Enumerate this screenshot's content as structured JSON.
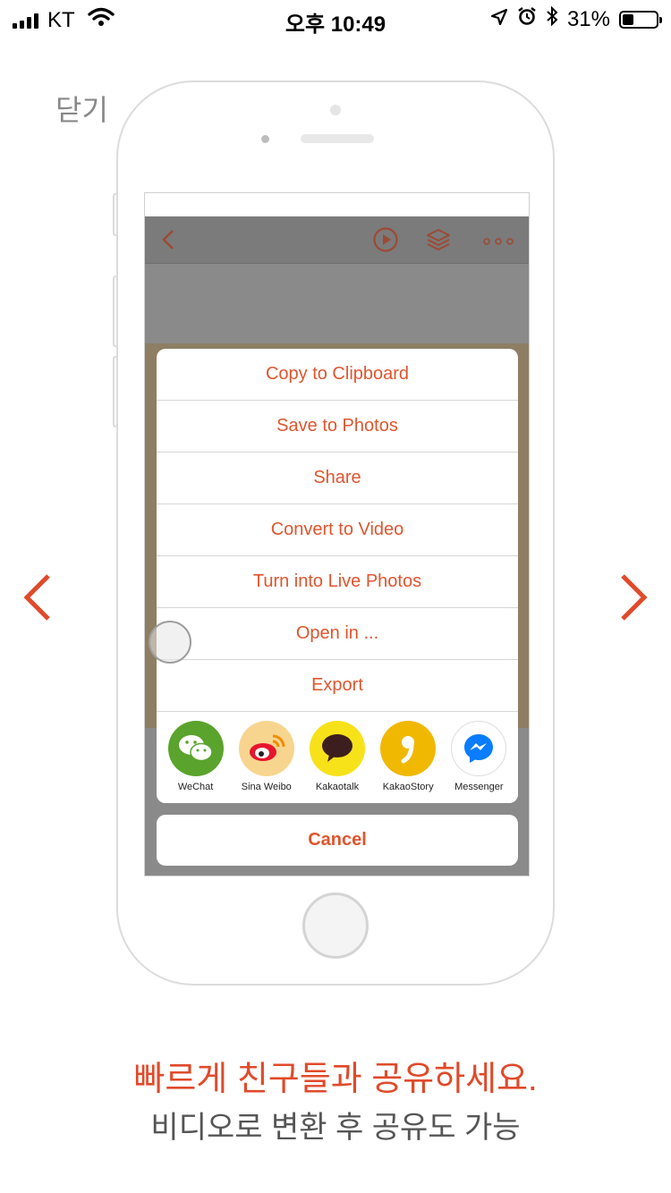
{
  "status_bar": {
    "carrier": "KT",
    "time": "오후 10:49",
    "battery_percent": "31%",
    "battery_level": 0.31,
    "icons": [
      "signal-icon",
      "wifi-icon",
      "location-icon",
      "alarm-icon",
      "bluetooth-icon",
      "battery-icon"
    ]
  },
  "close_label": "닫기",
  "app_toolbar": {
    "icons": [
      "back-chevron-icon",
      "play-icon",
      "layers-icon",
      "more-icon"
    ],
    "accent": "#e0552e"
  },
  "action_sheet": {
    "items": [
      {
        "label": "Copy to Clipboard"
      },
      {
        "label": "Save to Photos"
      },
      {
        "label": "Share"
      },
      {
        "label": "Convert to Video"
      },
      {
        "label": "Turn into Live Photos"
      },
      {
        "label": "Open in ..."
      },
      {
        "label": "Export"
      }
    ],
    "share_targets": [
      {
        "label": "WeChat",
        "icon": "wechat-icon",
        "color": "#5aa32c"
      },
      {
        "label": "Sina Weibo",
        "icon": "weibo-icon",
        "color": "#f7d58f"
      },
      {
        "label": "Kakaotalk",
        "icon": "kakaotalk-icon",
        "color": "#f7e21a"
      },
      {
        "label": "KakaoStory",
        "icon": "kakaostory-icon",
        "color": "#f0b800"
      },
      {
        "label": "Messenger",
        "icon": "messenger-icon",
        "color": "#ffffff"
      }
    ],
    "cancel_label": "Cancel"
  },
  "navigation": {
    "prev_icon": "chevron-left-icon",
    "next_icon": "chevron-right-icon",
    "color": "#e04a2a"
  },
  "caption": {
    "headline": "빠르게 친구들과 공유하세요.",
    "subline": "비디오로 변환 후 공유도 가능"
  }
}
